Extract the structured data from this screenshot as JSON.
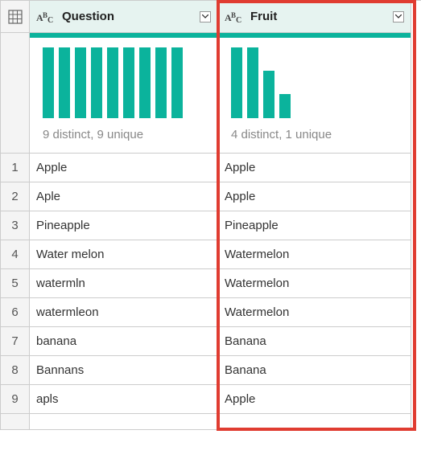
{
  "columns": {
    "question": {
      "label": "Question",
      "profile_summary": "9 distinct, 9 unique"
    },
    "fruit": {
      "label": "Fruit",
      "profile_summary": "4 distinct, 1 unique"
    }
  },
  "rows": [
    {
      "n": "1",
      "question": "Apple",
      "fruit": "Apple"
    },
    {
      "n": "2",
      "question": "Aple",
      "fruit": "Apple"
    },
    {
      "n": "3",
      "question": "Pineapple",
      "fruit": "Pineapple"
    },
    {
      "n": "4",
      "question": "Water melon",
      "fruit": "Watermelon"
    },
    {
      "n": "5",
      "question": "watermln",
      "fruit": "Watermelon"
    },
    {
      "n": "6",
      "question": "watermleon",
      "fruit": "Watermelon"
    },
    {
      "n": "7",
      "question": "banana",
      "fruit": "Banana"
    },
    {
      "n": "8",
      "question": "Bannans",
      "fruit": "Banana"
    },
    {
      "n": "9",
      "question": "apls",
      "fruit": "Apple"
    }
  ],
  "chart_data": [
    {
      "type": "bar",
      "column": "Question",
      "values": [
        1,
        1,
        1,
        1,
        1,
        1,
        1,
        1,
        1
      ],
      "summary": "9 distinct, 9 unique"
    },
    {
      "type": "bar",
      "column": "Fruit",
      "values": [
        3,
        3,
        2,
        1
      ],
      "summary": "4 distinct, 1 unique"
    }
  ]
}
